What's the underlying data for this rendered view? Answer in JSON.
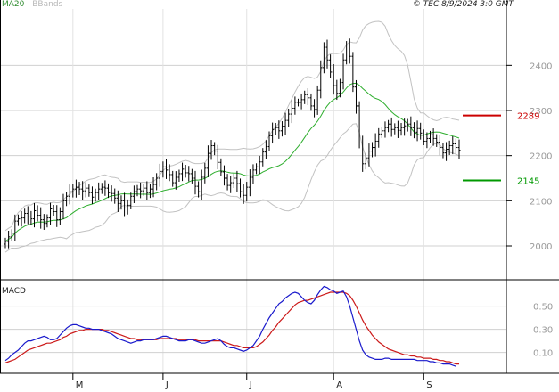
{
  "header": {
    "ma_label": "MA20",
    "bbands_label": "BBands",
    "stamp": "© TEC 8/9/2024 3:0 GMT"
  },
  "macd_panel": {
    "label": "MACD"
  },
  "colors": {
    "candle": "#000000",
    "ma": "#2eae2e",
    "bands": "#c2c2c2",
    "resistance": "#cc0000",
    "support": "#009900",
    "macd": "#1a1acc",
    "signal": "#cc1a1a",
    "grid": "#d0d0d0",
    "axis_text": "#9a9a9a"
  },
  "chart_data": [
    {
      "type": "candlestick",
      "panel": "price",
      "ylim": [
        1925,
        2525
      ],
      "yticks": [
        2000,
        2100,
        2200,
        2300,
        2400
      ],
      "ytick_labels": [
        "2000",
        "2100",
        "2200",
        "2300",
        "2400"
      ],
      "x_labels": [
        {
          "label": "M",
          "index": 21
        },
        {
          "label": "J",
          "index": 49
        },
        {
          "label": "J",
          "index": 75
        },
        {
          "label": "A",
          "index": 102
        },
        {
          "label": "S",
          "index": 130
        }
      ],
      "closes": [
        2010,
        2020,
        2028,
        2055,
        2060,
        2062,
        2072,
        2066,
        2060,
        2078,
        2068,
        2058,
        2050,
        2062,
        2082,
        2076,
        2058,
        2076,
        2100,
        2110,
        2120,
        2126,
        2130,
        2126,
        2122,
        2128,
        2118,
        2108,
        2118,
        2126,
        2130,
        2128,
        2118,
        2116,
        2106,
        2094,
        2100,
        2084,
        2090,
        2110,
        2120,
        2126,
        2122,
        2128,
        2118,
        2126,
        2136,
        2150,
        2165,
        2175,
        2168,
        2158,
        2140,
        2152,
        2160,
        2170,
        2162,
        2160,
        2150,
        2132,
        2120,
        2152,
        2172,
        2205,
        2222,
        2210,
        2185,
        2164,
        2150,
        2134,
        2140,
        2150,
        2138,
        2120,
        2112,
        2130,
        2152,
        2168,
        2175,
        2186,
        2208,
        2220,
        2244,
        2258,
        2262,
        2255,
        2265,
        2278,
        2292,
        2305,
        2318,
        2318,
        2324,
        2335,
        2328,
        2310,
        2302,
        2345,
        2395,
        2440,
        2412,
        2385,
        2355,
        2338,
        2362,
        2412,
        2445,
        2420,
        2352,
        2310,
        2228,
        2182,
        2195,
        2210,
        2218,
        2232,
        2248,
        2255,
        2262,
        2270,
        2258,
        2262,
        2256,
        2262,
        2266,
        2270,
        2262,
        2252,
        2260,
        2250,
        2232,
        2238,
        2246,
        2238,
        2230,
        2218,
        2206,
        2214,
        2222,
        2226,
        2218,
        2212
      ],
      "indicators": [
        {
          "name": "MA20",
          "kind": "moving-average",
          "period": 20,
          "color": "#2eae2e"
        },
        {
          "name": "BBands",
          "kind": "bollinger-bands",
          "period": 20,
          "color": "#c2c2c2"
        }
      ],
      "levels": [
        {
          "value": 2289,
          "label": "2289",
          "kind": "resistance",
          "color": "#cc0000"
        },
        {
          "value": 2145,
          "label": "2145",
          "kind": "support",
          "color": "#009900"
        }
      ]
    },
    {
      "type": "line",
      "panel": "macd",
      "ylim": [
        -0.08,
        0.72
      ],
      "yticks": [
        0.1,
        0.3,
        0.5
      ],
      "ytick_labels": [
        "0.10",
        "0.30",
        "0.50"
      ],
      "series": [
        {
          "name": "MACD",
          "values": [
            0.03,
            0.05,
            0.08,
            0.1,
            0.12,
            0.15,
            0.18,
            0.2,
            0.2,
            0.21,
            0.22,
            0.23,
            0.24,
            0.23,
            0.21,
            0.21,
            0.22,
            0.25,
            0.28,
            0.31,
            0.33,
            0.34,
            0.34,
            0.33,
            0.32,
            0.31,
            0.31,
            0.3,
            0.3,
            0.3,
            0.29,
            0.28,
            0.27,
            0.26,
            0.24,
            0.22,
            0.21,
            0.2,
            0.19,
            0.18,
            0.19,
            0.2,
            0.2,
            0.21,
            0.21,
            0.21,
            0.21,
            0.22,
            0.23,
            0.24,
            0.24,
            0.23,
            0.22,
            0.21,
            0.2,
            0.2,
            0.2,
            0.21,
            0.21,
            0.2,
            0.19,
            0.18,
            0.18,
            0.19,
            0.2,
            0.21,
            0.22,
            0.2,
            0.17,
            0.15,
            0.14,
            0.14,
            0.13,
            0.12,
            0.11,
            0.12,
            0.14,
            0.16,
            0.2,
            0.24,
            0.3,
            0.35,
            0.4,
            0.44,
            0.48,
            0.52,
            0.54,
            0.57,
            0.59,
            0.61,
            0.62,
            0.61,
            0.58,
            0.55,
            0.53,
            0.52,
            0.55,
            0.6,
            0.64,
            0.67,
            0.66,
            0.64,
            0.63,
            0.61,
            0.62,
            0.63,
            0.58,
            0.5,
            0.4,
            0.3,
            0.2,
            0.12,
            0.08,
            0.06,
            0.05,
            0.04,
            0.04,
            0.04,
            0.05,
            0.05,
            0.04,
            0.04,
            0.04,
            0.04,
            0.04,
            0.04,
            0.04,
            0.04,
            0.03,
            0.03,
            0.03,
            0.03,
            0.02,
            0.02,
            0.01,
            0.01,
            0.0,
            0.0,
            0.0,
            -0.01,
            -0.02
          ]
        },
        {
          "name": "Signal",
          "values": [
            0.01,
            0.02,
            0.03,
            0.04,
            0.06,
            0.08,
            0.1,
            0.12,
            0.13,
            0.14,
            0.15,
            0.16,
            0.17,
            0.18,
            0.18,
            0.19,
            0.2,
            0.21,
            0.23,
            0.24,
            0.26,
            0.27,
            0.28,
            0.29,
            0.29,
            0.3,
            0.3,
            0.3,
            0.3,
            0.3,
            0.3,
            0.29,
            0.29,
            0.28,
            0.27,
            0.26,
            0.25,
            0.24,
            0.23,
            0.22,
            0.22,
            0.21,
            0.21,
            0.21,
            0.21,
            0.21,
            0.21,
            0.21,
            0.22,
            0.22,
            0.22,
            0.22,
            0.22,
            0.22,
            0.21,
            0.21,
            0.21,
            0.21,
            0.21,
            0.21,
            0.2,
            0.2,
            0.2,
            0.2,
            0.2,
            0.2,
            0.2,
            0.2,
            0.19,
            0.18,
            0.17,
            0.16,
            0.16,
            0.15,
            0.14,
            0.14,
            0.14,
            0.14,
            0.15,
            0.17,
            0.19,
            0.22,
            0.25,
            0.29,
            0.32,
            0.36,
            0.39,
            0.42,
            0.45,
            0.48,
            0.51,
            0.53,
            0.54,
            0.55,
            0.55,
            0.56,
            0.57,
            0.58,
            0.59,
            0.6,
            0.61,
            0.62,
            0.62,
            0.62,
            0.62,
            0.62,
            0.61,
            0.59,
            0.55,
            0.5,
            0.44,
            0.38,
            0.33,
            0.29,
            0.25,
            0.22,
            0.19,
            0.17,
            0.15,
            0.13,
            0.12,
            0.11,
            0.1,
            0.09,
            0.08,
            0.08,
            0.07,
            0.07,
            0.06,
            0.06,
            0.05,
            0.05,
            0.05,
            0.04,
            0.04,
            0.03,
            0.03,
            0.02,
            0.02,
            0.01,
            0.0,
            0.0
          ]
        }
      ]
    }
  ]
}
